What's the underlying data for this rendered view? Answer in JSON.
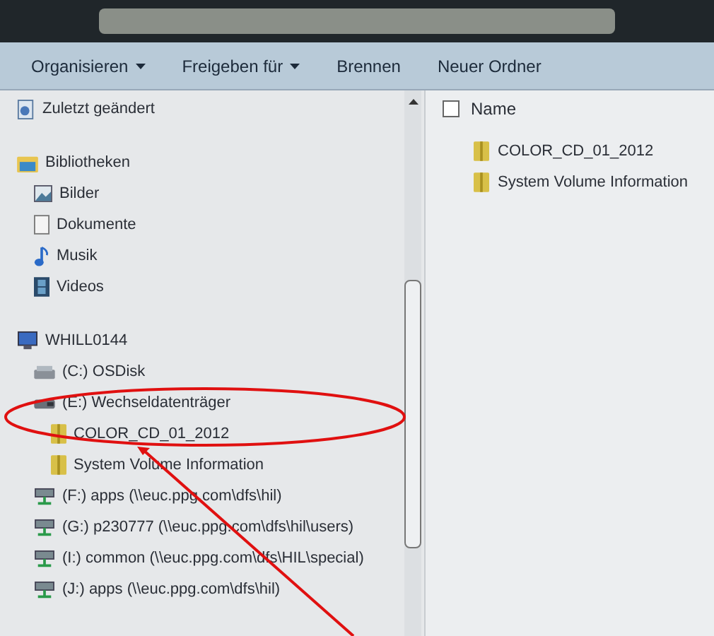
{
  "toolbar": {
    "items": [
      {
        "label": "Organisieren",
        "dropdown": true
      },
      {
        "label": "Freigeben für",
        "dropdown": true
      },
      {
        "label": "Brennen",
        "dropdown": false
      },
      {
        "label": "Neuer Ordner",
        "dropdown": false
      }
    ]
  },
  "navigation": {
    "groups": [
      {
        "items": [
          {
            "label": "Zuletzt geändert",
            "kind": "recent"
          }
        ]
      },
      {
        "items": [
          {
            "label": "Bibliotheken",
            "kind": "library",
            "children": [
              {
                "label": "Bilder",
                "kind": "pictures"
              },
              {
                "label": "Dokumente",
                "kind": "documents"
              },
              {
                "label": "Musik",
                "kind": "music"
              },
              {
                "label": "Videos",
                "kind": "videos"
              }
            ]
          }
        ]
      },
      {
        "items": [
          {
            "label": "WHILL0144",
            "kind": "computer",
            "children": [
              {
                "label": "(C:) OSDisk",
                "kind": "disk"
              },
              {
                "label": "(E:) Wechseldatenträger",
                "kind": "removable",
                "children": [
                  {
                    "label": "COLOR_CD_01_2012",
                    "kind": "folder"
                  },
                  {
                    "label": "System Volume Information",
                    "kind": "folder"
                  }
                ]
              },
              {
                "label": "(F:) apps (\\\\euc.ppg.com\\dfs\\hil)",
                "kind": "network"
              },
              {
                "label": "(G:) p230777 (\\\\euc.ppg.com\\dfs\\hil\\users)",
                "kind": "network"
              },
              {
                "label": "(I:) common (\\\\euc.ppg.com\\dfs\\HIL\\special)",
                "kind": "network"
              },
              {
                "label": "(J:) apps (\\\\euc.ppg.com\\dfs\\hil)",
                "kind": "network"
              }
            ]
          }
        ]
      }
    ]
  },
  "file_list": {
    "column": "Name",
    "checked": false,
    "files": [
      {
        "name": "COLOR_CD_01_2012"
      },
      {
        "name": "System Volume Information"
      }
    ]
  }
}
